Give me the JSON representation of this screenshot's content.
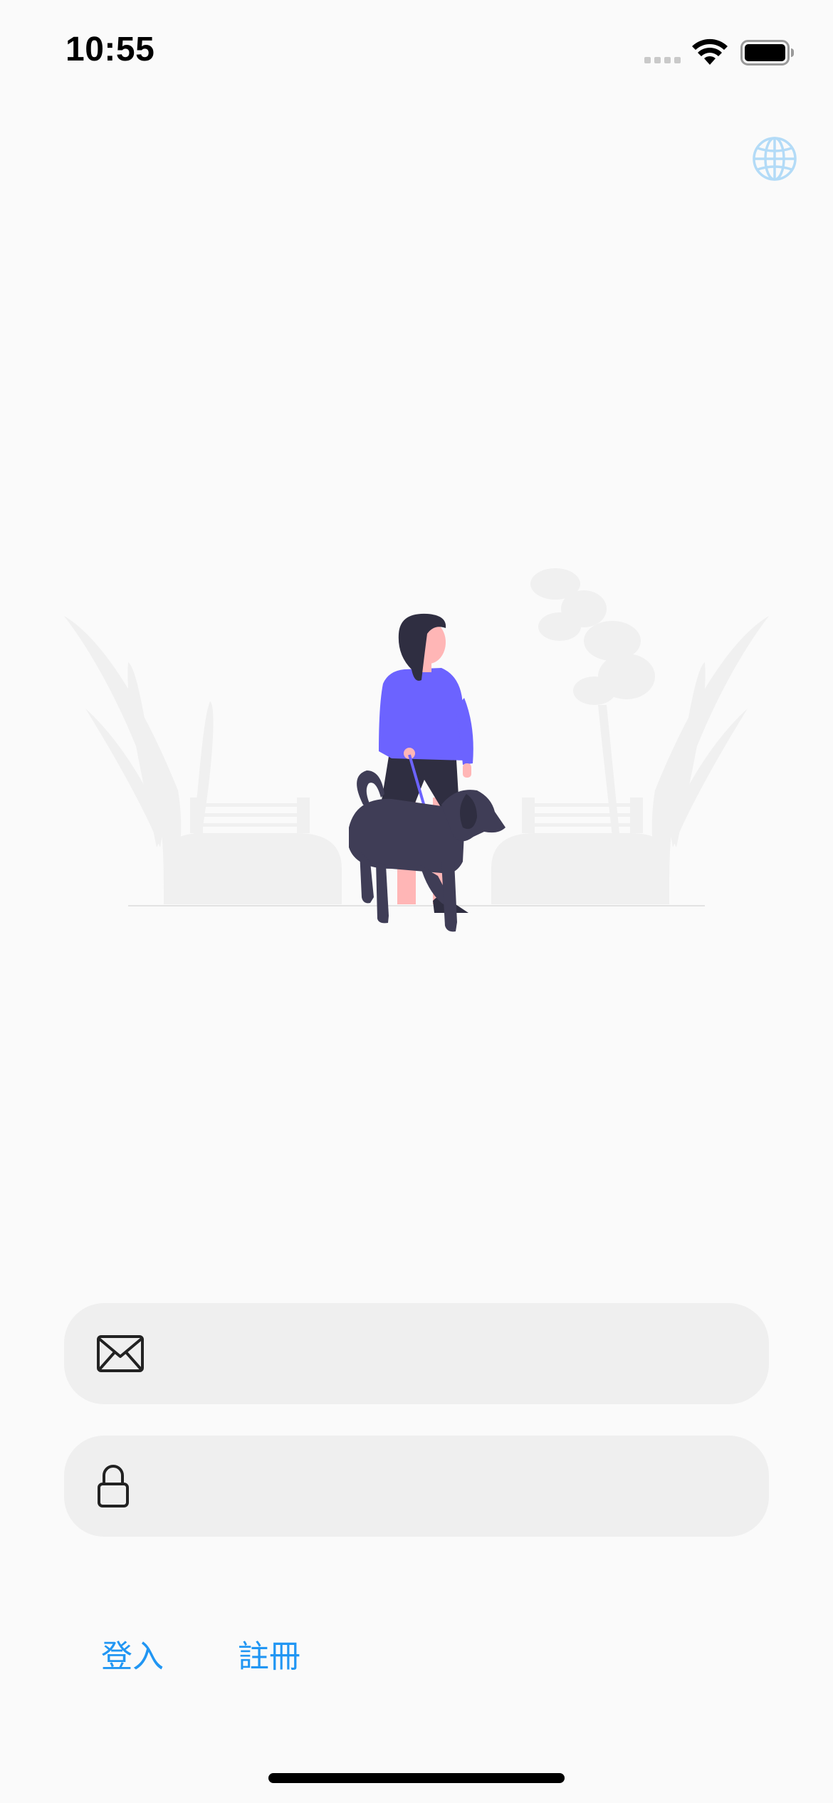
{
  "status_bar": {
    "time": "10:55",
    "icons": [
      "cellular-signal-icon",
      "wifi-icon",
      "battery-icon"
    ]
  },
  "header": {
    "language_icon": "globe-icon"
  },
  "form": {
    "email": {
      "icon": "envelope-icon",
      "value": "",
      "placeholder": ""
    },
    "password": {
      "icon": "lock-icon",
      "value": "",
      "placeholder": ""
    }
  },
  "actions": {
    "login_label": "登入",
    "register_label": "註冊"
  },
  "colors": {
    "background": "#fafafa",
    "field_background": "#efefef",
    "link_blue": "#2196f3",
    "globe_blue": "#b3dbf7",
    "jacket_purple": "#6c63ff",
    "dog_dark": "#3f3d56"
  }
}
